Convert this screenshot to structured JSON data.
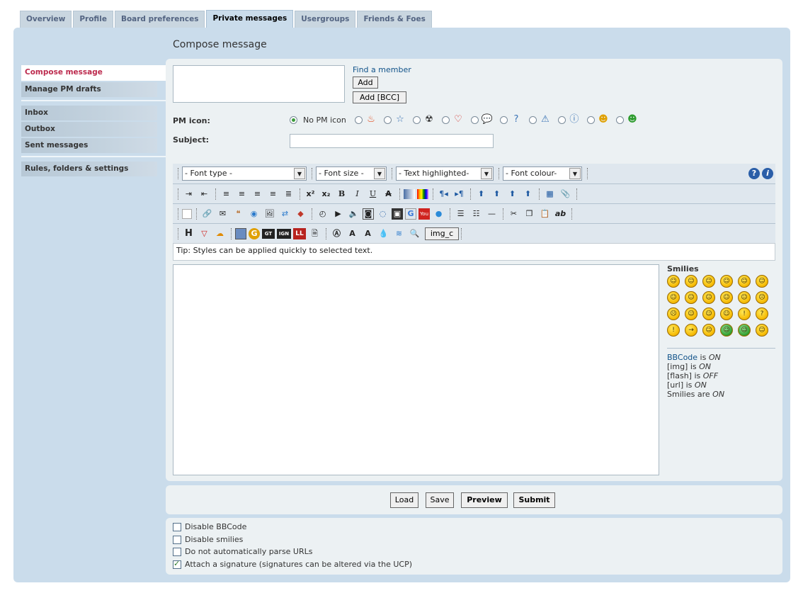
{
  "tabs": [
    "Overview",
    "Profile",
    "Board preferences",
    "Private messages",
    "Usergroups",
    "Friends & Foes"
  ],
  "active_tab": "Private messages",
  "page_title": "Compose message",
  "sidebar": {
    "active": "Compose message",
    "group1": [
      "Manage PM drafts"
    ],
    "group2": [
      "Inbox",
      "Outbox",
      "Sent messages"
    ],
    "group3": [
      "Rules, folders & settings"
    ]
  },
  "recipients": {
    "find_member": "Find a member",
    "add": "Add",
    "add_bcc": "Add [BCC]"
  },
  "pm_icon": {
    "label": "PM icon:",
    "no_icon": "No PM icon",
    "icons": [
      "fire-icon",
      "star-icon",
      "radioactive-icon",
      "heart-icon",
      "speech-bubble-icon",
      "question-icon",
      "warning-icon",
      "info-icon",
      "smiley-icon",
      "grin-icon"
    ]
  },
  "subject": {
    "label": "Subject:",
    "value": ""
  },
  "toolbar": {
    "font_type": "- Font type -",
    "font_size": "- Font size -",
    "highlight": "- Text highlighted-",
    "font_colour": "- Font colour-",
    "img_button": "img_c",
    "tip": "Tip: Styles can be applied quickly to selected text."
  },
  "message": "",
  "smilies": {
    "title": "Smilies",
    "count": 24
  },
  "bbcode_status": {
    "bbcode_link": "BBCode",
    "bbcode_rest": " is ",
    "bbcode_val": "ON",
    "img": "[img] is ",
    "img_val": "ON",
    "flash": "[flash] is ",
    "flash_val": "OFF",
    "url": "[url] is ",
    "url_val": "ON",
    "smilies": "Smilies are ",
    "smilies_val": "ON"
  },
  "buttons": {
    "load": "Load",
    "save": "Save",
    "preview": "Preview",
    "submit": "Submit"
  },
  "options": [
    {
      "label": "Disable BBCode",
      "checked": false
    },
    {
      "label": "Disable smilies",
      "checked": false
    },
    {
      "label": "Do not automatically parse URLs",
      "checked": false
    },
    {
      "label": "Attach a signature (signatures can be altered via the UCP)",
      "checked": true
    }
  ]
}
